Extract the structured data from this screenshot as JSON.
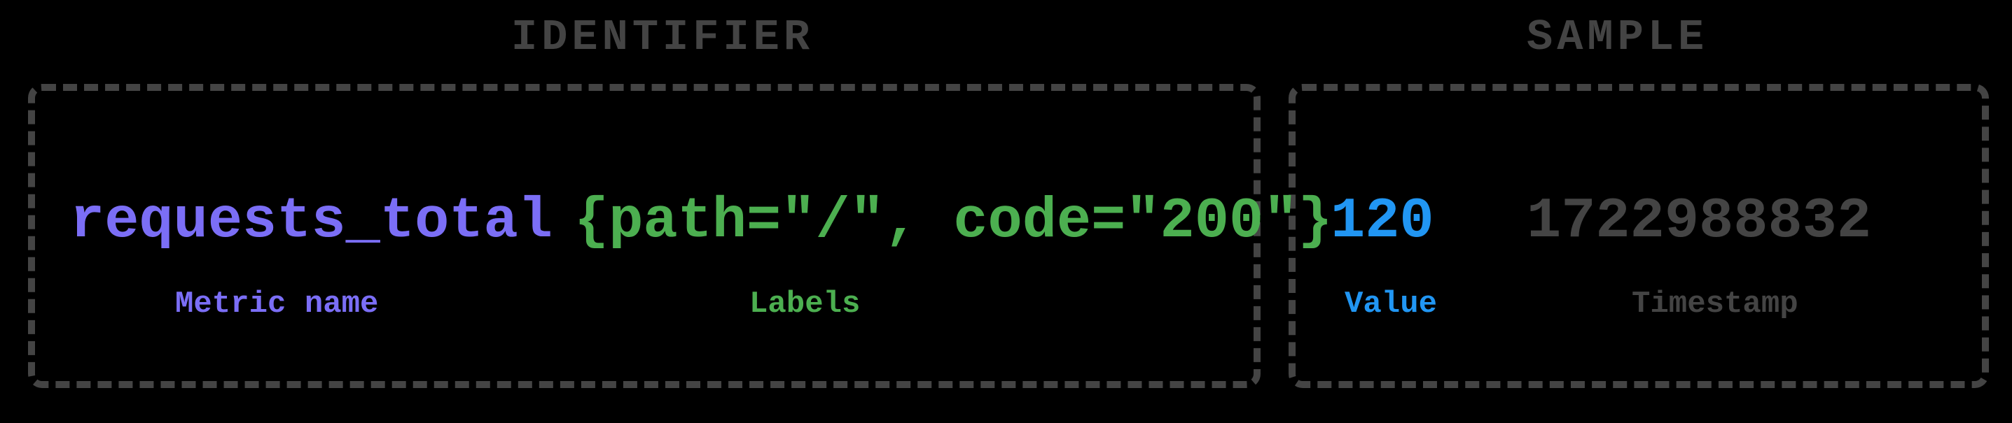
{
  "sections": {
    "identifier": {
      "title": "IDENTIFIER"
    },
    "sample": {
      "title": "SAMPLE"
    }
  },
  "metric": {
    "name": "requests_total",
    "labels_raw": "{path=\"/\", code=\"200\"}",
    "labels": [
      {
        "key": "path",
        "value": "/"
      },
      {
        "key": "code",
        "value": "200"
      }
    ]
  },
  "sample": {
    "value": "120",
    "timestamp": "1722988832"
  },
  "captions": {
    "metric_name": "Metric name",
    "labels": "Labels",
    "value": "Value",
    "timestamp": "Timestamp"
  }
}
